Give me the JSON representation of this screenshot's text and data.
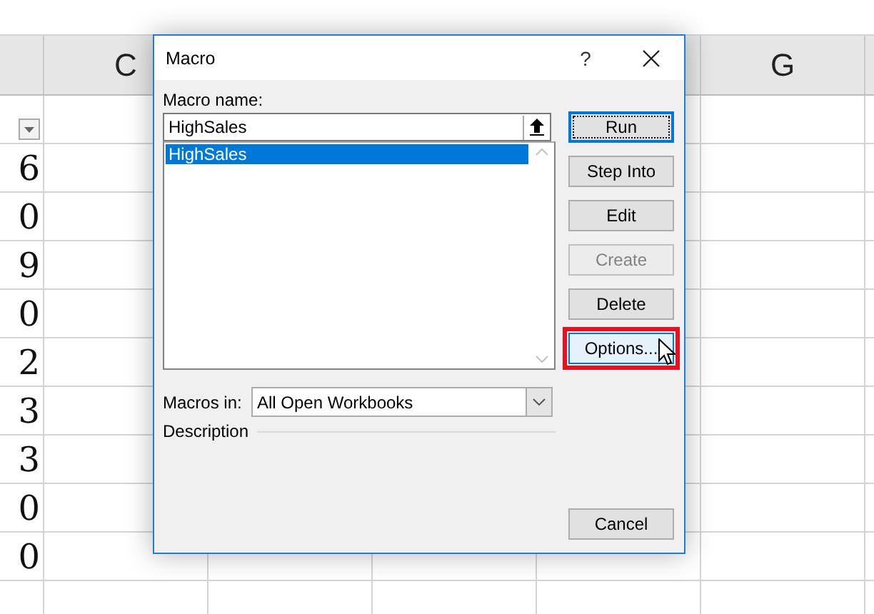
{
  "sheet": {
    "columns": [
      {
        "label": "C"
      },
      {
        "label": "G"
      }
    ],
    "rows": [
      {
        "filter": true
      },
      {
        "value": "6"
      },
      {
        "value": "0"
      },
      {
        "value": "9"
      },
      {
        "value": "0"
      },
      {
        "value": "2"
      },
      {
        "value": "3"
      },
      {
        "value": "3"
      },
      {
        "value": "0"
      },
      {
        "value": "0"
      }
    ]
  },
  "dialog": {
    "title": "Macro",
    "help": "?",
    "macro_name": {
      "label": "Macro name:",
      "value": "HighSales"
    },
    "macro_list": [
      {
        "name": "HighSales",
        "selected": true
      }
    ],
    "buttons": [
      {
        "label": "Run",
        "kind": "default",
        "disabled": false,
        "hovered": false,
        "highlighted": false
      },
      {
        "label": "Step Into",
        "kind": "normal",
        "disabled": false,
        "hovered": false,
        "highlighted": false
      },
      {
        "label": "Edit",
        "kind": "normal",
        "disabled": false,
        "hovered": false,
        "highlighted": false
      },
      {
        "label": "Create",
        "kind": "normal",
        "disabled": true,
        "hovered": false,
        "highlighted": false
      },
      {
        "label": "Delete",
        "kind": "normal",
        "disabled": false,
        "hovered": false,
        "highlighted": false
      },
      {
        "label": "Options...",
        "kind": "normal",
        "disabled": false,
        "hovered": true,
        "highlighted": true
      },
      {
        "label": "Cancel",
        "kind": "cancel",
        "disabled": false,
        "hovered": false,
        "highlighted": false
      }
    ],
    "macros_in": {
      "label": "Macros in:",
      "value": "All Open Workbooks"
    },
    "description": {
      "label": "Description"
    }
  }
}
